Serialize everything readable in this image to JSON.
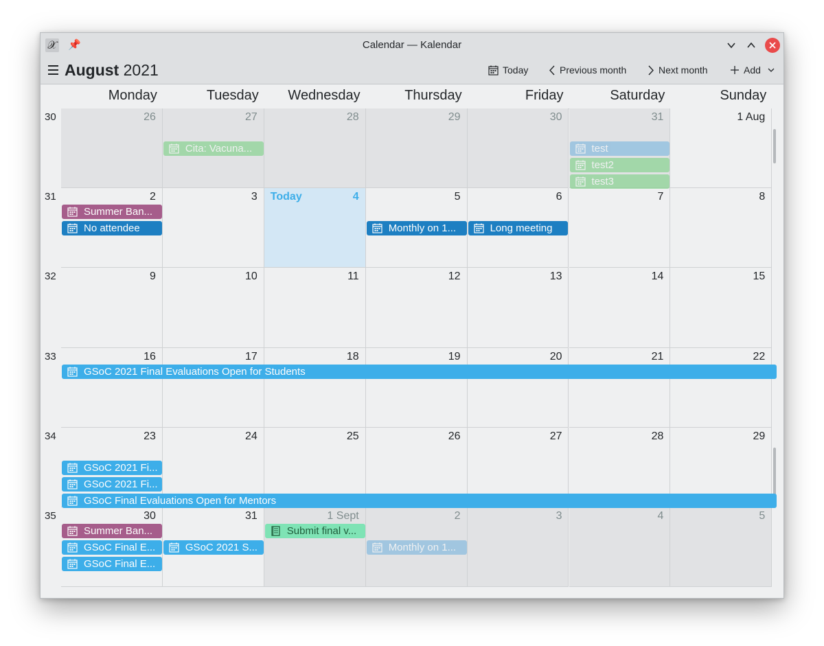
{
  "window": {
    "title": "Calendar — Kalendar"
  },
  "toolbar": {
    "month": "August",
    "year": "2021",
    "today_label": "Today",
    "prev_label": "Previous month",
    "next_label": "Next month",
    "add_label": "Add"
  },
  "weekdays": [
    "Monday",
    "Tuesday",
    "Wednesday",
    "Thursday",
    "Friday",
    "Saturday",
    "Sunday"
  ],
  "weeks": [
    {
      "number": "30",
      "days": [
        "26",
        "27",
        "28",
        "29",
        "30",
        "31",
        "1 Aug"
      ],
      "in_month": [
        false,
        false,
        false,
        false,
        false,
        false,
        true
      ]
    },
    {
      "number": "31",
      "days": [
        "2",
        "3",
        "4",
        "5",
        "6",
        "7",
        "8"
      ],
      "in_month": [
        true,
        true,
        true,
        true,
        true,
        true,
        true
      ]
    },
    {
      "number": "32",
      "days": [
        "9",
        "10",
        "11",
        "12",
        "13",
        "14",
        "15"
      ],
      "in_month": [
        true,
        true,
        true,
        true,
        true,
        true,
        true
      ]
    },
    {
      "number": "33",
      "days": [
        "16",
        "17",
        "18",
        "19",
        "20",
        "21",
        "22"
      ],
      "in_month": [
        true,
        true,
        true,
        true,
        true,
        true,
        true
      ]
    },
    {
      "number": "34",
      "days": [
        "23",
        "24",
        "25",
        "26",
        "27",
        "28",
        "29"
      ],
      "in_month": [
        true,
        true,
        true,
        true,
        true,
        true,
        true
      ]
    },
    {
      "number": "35",
      "days": [
        "30",
        "31",
        "1 Sept",
        "2",
        "3",
        "4",
        "5"
      ],
      "in_month": [
        true,
        true,
        false,
        false,
        false,
        false,
        false
      ]
    }
  ],
  "today": {
    "label": "Today",
    "week": 1,
    "day": 2
  },
  "events": [
    {
      "title": "Cita: Vacuna...",
      "color": "#6fcf7a",
      "week": 0,
      "day": 1,
      "span": 1,
      "row": 1,
      "faded": true,
      "icon": "calendar-icon"
    },
    {
      "title": "test",
      "color": "#6db0de",
      "week": 0,
      "day": 5,
      "span": 1,
      "row": 1,
      "faded": true,
      "icon": "calendar-icon"
    },
    {
      "title": "test2",
      "color": "#6fcf7a",
      "week": 0,
      "day": 5,
      "span": 1,
      "row": 2,
      "faded": true,
      "icon": "calendar-icon"
    },
    {
      "title": "test3",
      "color": "#6fcf7a",
      "week": 0,
      "day": 5,
      "span": 1,
      "row": 3,
      "faded": true,
      "icon": "calendar-icon"
    },
    {
      "title": "Summer Ban...",
      "color": "#a65d8b",
      "week": 1,
      "day": 0,
      "span": 1,
      "row": 0,
      "faded": false,
      "icon": "calendar-icon"
    },
    {
      "title": "No attendee",
      "color": "#1d7fc2",
      "week": 1,
      "day": 0,
      "span": 1,
      "row": 1,
      "faded": false,
      "icon": "calendar-icon"
    },
    {
      "title": "Monthly on 1...",
      "color": "#1d7fc2",
      "week": 1,
      "day": 3,
      "span": 1,
      "row": 1,
      "faded": false,
      "icon": "calendar-icon"
    },
    {
      "title": "Long meeting",
      "color": "#1d7fc2",
      "week": 1,
      "day": 4,
      "span": 1,
      "row": 1,
      "faded": false,
      "icon": "calendar-icon"
    },
    {
      "title": "GSoC 2021 Final Evaluations Open for Students",
      "color": "#3daee9",
      "week": 3,
      "day": 0,
      "span": 7,
      "row": 0,
      "faded": false,
      "icon": "calendar-icon"
    },
    {
      "title": "GSoC 2021 Fi...",
      "color": "#3daee9",
      "week": 4,
      "day": 0,
      "span": 1,
      "row": 1,
      "faded": false,
      "icon": "calendar-icon"
    },
    {
      "title": "GSoC 2021 Fi...",
      "color": "#3daee9",
      "week": 4,
      "day": 0,
      "span": 1,
      "row": 2,
      "faded": false,
      "icon": "calendar-icon"
    },
    {
      "title": "GSoC Final Evaluations Open for Mentors",
      "color": "#3daee9",
      "week": 4,
      "day": 0,
      "span": 7,
      "row": 3,
      "faded": false,
      "icon": "calendar-icon"
    },
    {
      "title": "Summer Ban...",
      "color": "#a65d8b",
      "week": 5,
      "day": 0,
      "span": 1,
      "row": 0,
      "faded": false,
      "icon": "calendar-icon"
    },
    {
      "title": "GSoC Final E...",
      "color": "#3daee9",
      "week": 5,
      "day": 0,
      "span": 1,
      "row": 1,
      "faded": false,
      "icon": "calendar-icon"
    },
    {
      "title": "GSoC Final E...",
      "color": "#3daee9",
      "week": 5,
      "day": 0,
      "span": 1,
      "row": 2,
      "faded": false,
      "icon": "calendar-icon"
    },
    {
      "title": "GSoC 2021 S...",
      "color": "#3daee9",
      "week": 5,
      "day": 1,
      "span": 1,
      "row": 1,
      "faded": false,
      "icon": "calendar-icon"
    },
    {
      "title": "Submit final v...",
      "color": "#7fe3b5",
      "week": 5,
      "day": 2,
      "span": 1,
      "row": 0,
      "faded": false,
      "icon": "todo-list-icon",
      "text_color": "#1f5c3a"
    },
    {
      "title": "Monthly on 1...",
      "color": "#6db0de",
      "week": 5,
      "day": 3,
      "span": 1,
      "row": 1,
      "faded": true,
      "icon": "calendar-icon"
    }
  ]
}
